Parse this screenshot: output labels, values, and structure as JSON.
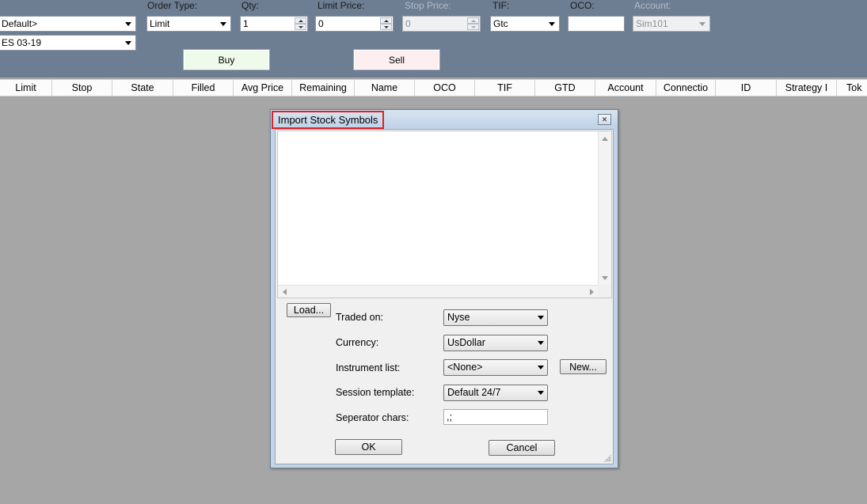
{
  "order_entry": {
    "labels": {
      "order_type": "Order Type:",
      "qty": "Qty:",
      "limit_price": "Limit Price:",
      "stop_price": "Stop Price:",
      "tif": "TIF:",
      "oco": "OCO:",
      "account": "Account:"
    },
    "atm_strategy": "Default>",
    "instrument": "ES 03-19",
    "order_type": "Limit",
    "qty": "1",
    "limit_price": "0",
    "stop_price": "0",
    "tif": "Gtc",
    "oco": "",
    "account": "Sim101",
    "buy_label": "Buy",
    "sell_label": "Sell"
  },
  "grid": {
    "columns": [
      "Limit",
      "Stop",
      "State",
      "Filled",
      "Avg Price",
      "Remaining",
      "Name",
      "OCO",
      "TIF",
      "GTD",
      "Account",
      "Connectio",
      "ID",
      "Strategy I",
      "Tok"
    ]
  },
  "dialog": {
    "title": "Import Stock Symbols",
    "close_glyph": "✕",
    "symbols_text": "",
    "load_label": "Load...",
    "traded_on_label": "Traded on:",
    "traded_on_value": "Nyse",
    "currency_label": "Currency:",
    "currency_value": "UsDollar",
    "instrument_list_label": "Instrument list:",
    "instrument_list_value": "<None>",
    "new_label": "New...",
    "session_template_label": "Session template:",
    "session_template_value": "Default 24/7",
    "separator_label": "Seperator chars:",
    "separator_value": ",;",
    "ok_label": "OK",
    "cancel_label": "Cancel"
  },
  "colors": {
    "panel_bg": "#6d7d92",
    "workspace_bg": "#a6a6a6",
    "buy_bg": "#eefbea",
    "sell_bg": "#fdeef0",
    "title_highlight": "#e0202a"
  }
}
